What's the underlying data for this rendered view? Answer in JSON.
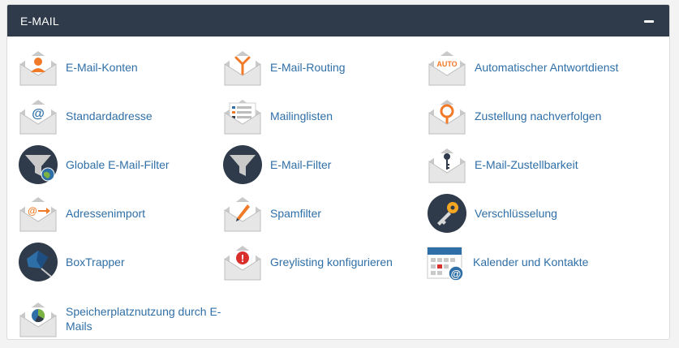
{
  "panel": {
    "title": "E-MAIL"
  },
  "items": [
    {
      "label": "E-Mail-Konten",
      "icon": "envelope-user-icon"
    },
    {
      "label": "E-Mail-Routing",
      "icon": "envelope-routing-icon"
    },
    {
      "label": "Automatischer Antwortdienst",
      "icon": "envelope-auto-icon",
      "icon_text": "AUTO"
    },
    {
      "label": "Standardadresse",
      "icon": "envelope-at-icon",
      "icon_text": "@"
    },
    {
      "label": "Mailinglisten",
      "icon": "envelope-list-icon"
    },
    {
      "label": "Zustellung nachverfolgen",
      "icon": "envelope-location-pin-icon"
    },
    {
      "label": "Globale E-Mail-Filter",
      "icon": "funnel-globe-icon"
    },
    {
      "label": "E-Mail-Filter",
      "icon": "funnel-icon"
    },
    {
      "label": "E-Mail-Zustellbarkeit",
      "icon": "envelope-key-icon"
    },
    {
      "label": "Adressenimport",
      "icon": "envelope-at-arrow-icon",
      "icon_text": "@"
    },
    {
      "label": "Spamfilter",
      "icon": "envelope-pen-icon"
    },
    {
      "label": "Verschlüsselung",
      "icon": "key-circle-icon"
    },
    {
      "label": "BoxTrapper",
      "icon": "box-trap-icon"
    },
    {
      "label": "Greylisting konfigurieren",
      "icon": "envelope-warning-icon",
      "icon_text": "!"
    },
    {
      "label": "Kalender und Kontakte",
      "icon": "calendar-at-icon",
      "icon_text": "@"
    },
    {
      "label": "Speicherplatznutzung durch E-Mails",
      "icon": "envelope-pie-chart-icon"
    }
  ],
  "colors": {
    "header_bg": "#2f3b4b",
    "link": "#2f6fa7",
    "accent_orange": "#f07a27",
    "dark_circle": "#2f3b4b"
  }
}
